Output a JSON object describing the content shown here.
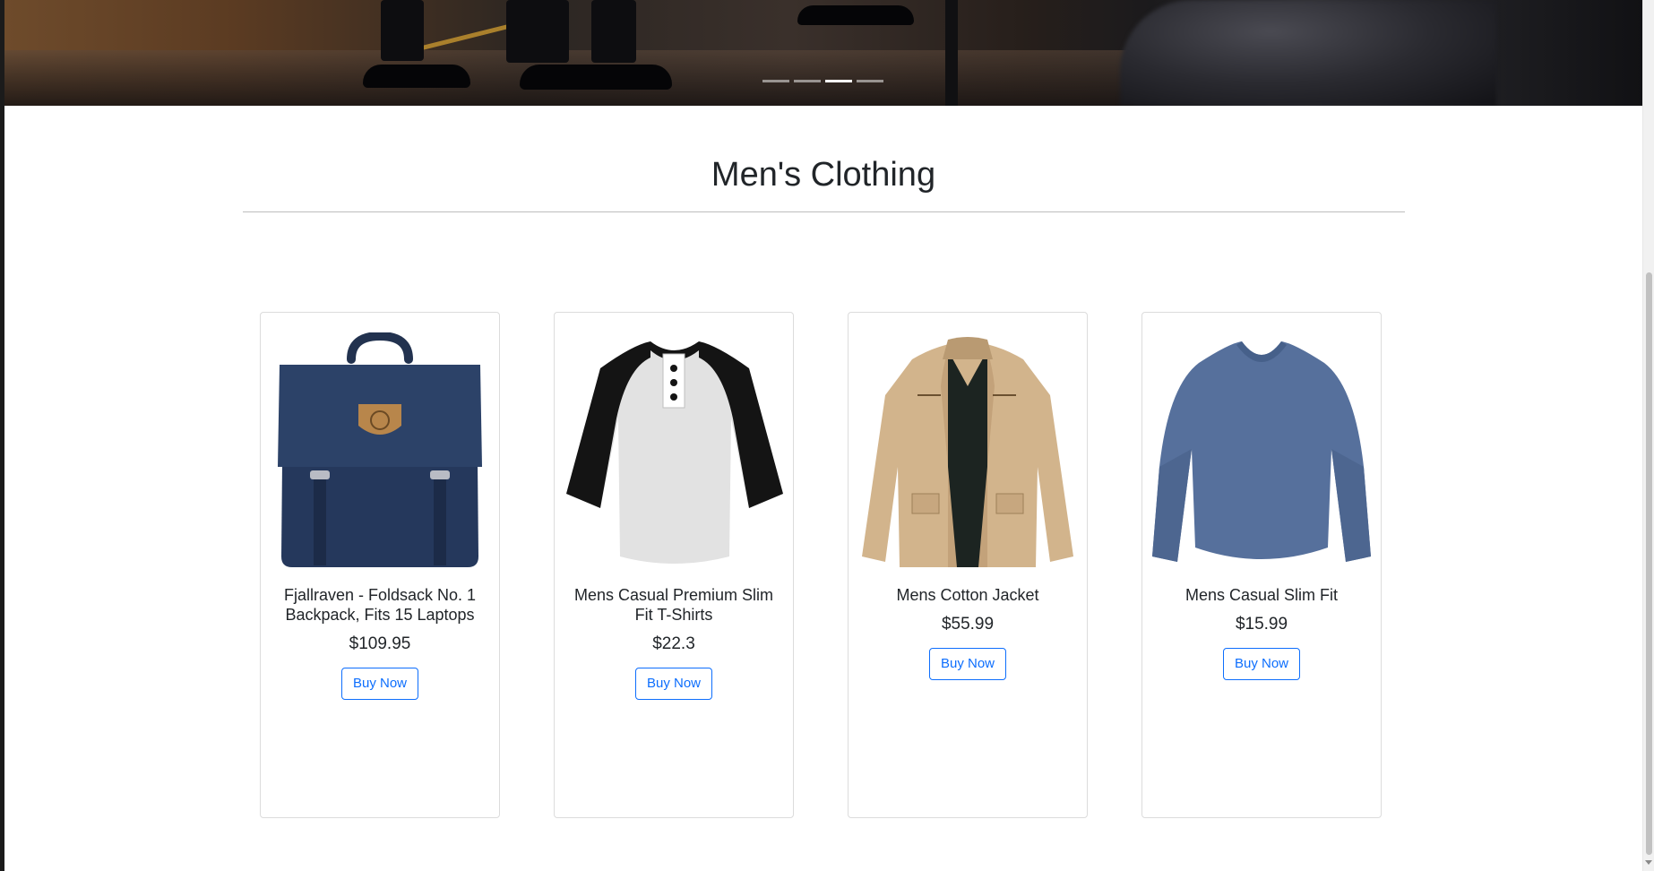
{
  "hero": {
    "slide_count": 4,
    "active_slide": 3
  },
  "section": {
    "title": "Men's Clothing"
  },
  "products": [
    {
      "title": "Fjallraven - Foldsack No. 1 Backpack, Fits 15 Laptops",
      "price": "$109.95",
      "button_label": "Buy Now",
      "image_icon": "backpack-image"
    },
    {
      "title": "Mens Casual Premium Slim Fit T-Shirts",
      "price": "$22.3",
      "button_label": "Buy Now",
      "image_icon": "tshirt-image"
    },
    {
      "title": "Mens Cotton Jacket",
      "price": "$55.99",
      "button_label": "Buy Now",
      "image_icon": "jacket-image"
    },
    {
      "title": "Mens Casual Slim Fit",
      "price": "$15.99",
      "button_label": "Buy Now",
      "image_icon": "longsleeve-image"
    }
  ],
  "colors": {
    "accent": "#0d6efd",
    "text": "#212529",
    "divider": "#bdbdbd",
    "card_border": "#dcdcdc"
  }
}
